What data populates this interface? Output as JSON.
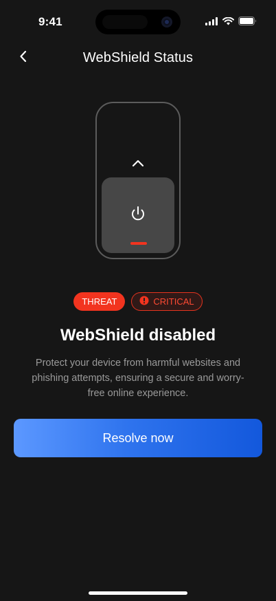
{
  "status_bar": {
    "time": "9:41"
  },
  "nav": {
    "title": "WebShield Status",
    "back_icon": "chevron-left-icon"
  },
  "illustration": {
    "arrow_icon": "chevron-up-icon",
    "power_icon": "power-icon",
    "indicator_color": "#f2341f"
  },
  "badges": {
    "threat_label": "THREAT",
    "critical_label": "CRITICAL",
    "critical_icon": "alert-icon"
  },
  "main": {
    "headline": "WebShield disabled",
    "description": "Protect your device from harmful websites and phishing attempts, ensuring a secure and worry-free online experience."
  },
  "actions": {
    "resolve_label": "Resolve now"
  },
  "colors": {
    "background": "#161616",
    "danger": "#f2341f",
    "accent_start": "#5c98ff",
    "accent_end": "#1358dc"
  }
}
